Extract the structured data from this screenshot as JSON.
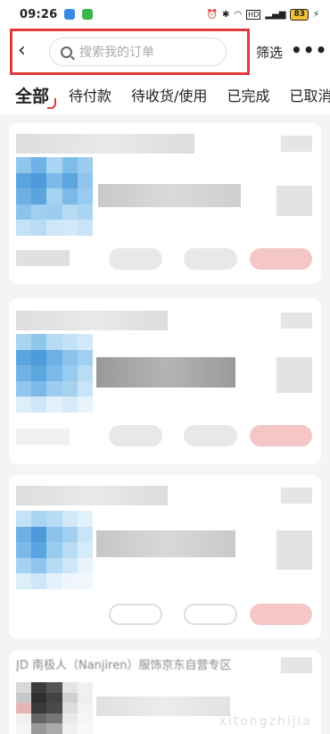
{
  "status_bar": {
    "time": "09:26",
    "battery": "83"
  },
  "header": {
    "search_placeholder": "搜索我的订单",
    "filter_label": "筛选",
    "more_label": "•••"
  },
  "tabs": [
    {
      "label": "全部",
      "active": true
    },
    {
      "label": "待付款",
      "active": false
    },
    {
      "label": "待收货/使用",
      "active": false
    },
    {
      "label": "已完成",
      "active": false
    },
    {
      "label": "已取消",
      "active": false
    }
  ],
  "orders": [
    {
      "shop_name": "",
      "title": "",
      "status": ""
    },
    {
      "shop_name": "",
      "title": "",
      "status": ""
    },
    {
      "shop_name": "",
      "title": "",
      "status": ""
    },
    {
      "shop_name": "JD 南极人（Nanjiren）服饰京东自营专区",
      "title": "",
      "status": ""
    }
  ],
  "watermark": "xitongzhijia"
}
